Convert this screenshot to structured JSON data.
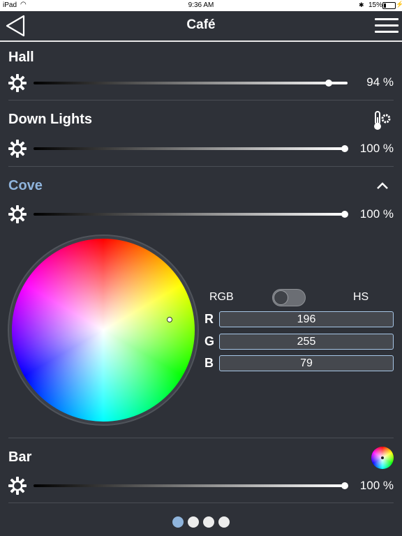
{
  "status_bar": {
    "carrier": "iPad",
    "time": "9:36 AM",
    "battery": "15%"
  },
  "nav": {
    "title": "Café"
  },
  "zones": [
    {
      "name": "Hall",
      "level": 94,
      "level_text": "94 %"
    },
    {
      "name": "Down Lights",
      "level": 100,
      "level_text": "100 %"
    },
    {
      "name": "Cove",
      "level": 100,
      "level_text": "100 %"
    },
    {
      "name": "Bar",
      "level": 100,
      "level_text": "100 %"
    }
  ],
  "color_picker": {
    "mode_left": "RGB",
    "mode_right": "HS",
    "channels": [
      {
        "label": "R",
        "value": "196"
      },
      {
        "label": "G",
        "value": "255"
      },
      {
        "label": "B",
        "value": "79"
      }
    ]
  },
  "pager": {
    "pages": 4,
    "current": 1
  },
  "colors": {
    "background": "#2e3138",
    "accent": "#8fb4dc",
    "text": "#ffffff"
  },
  "icons": {
    "back": "back-triangle-icon",
    "menu": "hamburger-menu-icon",
    "brightness": "sun-icon",
    "thermometer": "thermometer-gear-icon",
    "collapse": "chevron-up-icon",
    "color": "color-wheel-icon"
  }
}
